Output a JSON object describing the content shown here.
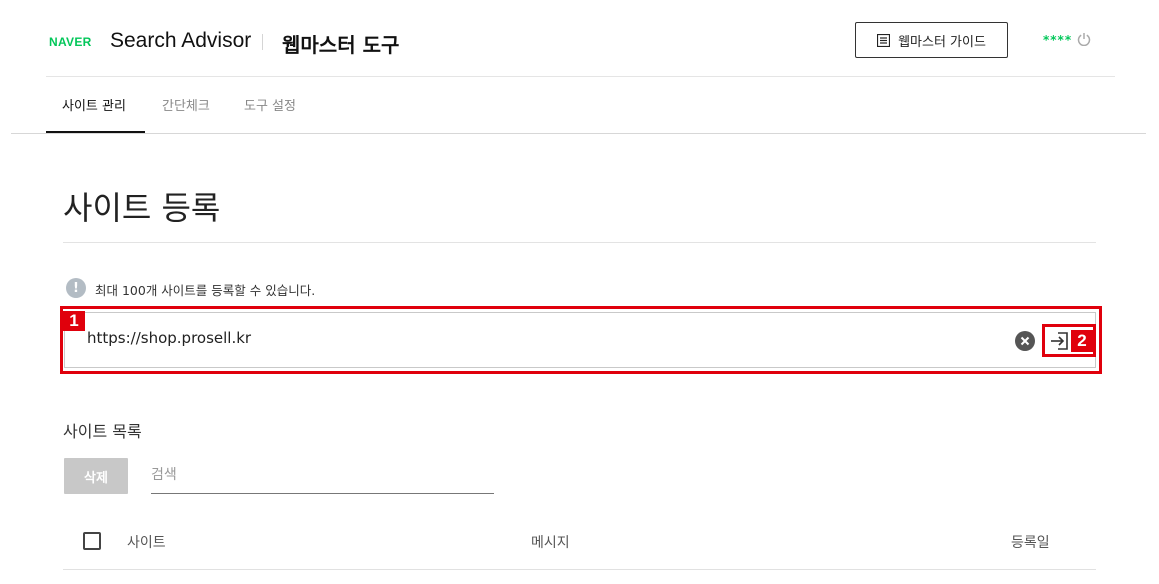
{
  "header": {
    "naver_logo": "NAVER",
    "title": "Search Advisor",
    "subtitle": "웹마스터 도구",
    "guide_button": "웹마스터 가이드",
    "user_name": "****"
  },
  "tabs": [
    {
      "label": "사이트 관리",
      "active": true
    },
    {
      "label": "간단체크",
      "active": false
    },
    {
      "label": "도구 설정",
      "active": false
    }
  ],
  "page": {
    "title": "사이트 등록",
    "notice": "최대 100개 사이트를 등록할 수 있습니다.",
    "notice_icon": "!"
  },
  "site_input": {
    "value": "https://shop.prosell.kr"
  },
  "annotations": {
    "badge_1": "1",
    "badge_2": "2"
  },
  "site_list": {
    "title": "사이트 목록",
    "delete_button": "삭제",
    "search_placeholder": "검색",
    "columns": [
      "사이트",
      "메시지",
      "등록일"
    ]
  },
  "colors": {
    "brand": "#03c75a",
    "annotation": "#e0000c"
  }
}
